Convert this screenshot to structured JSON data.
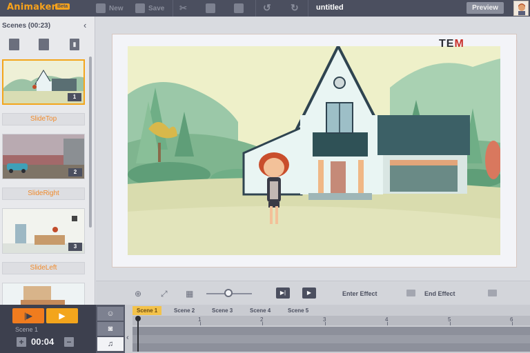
{
  "header": {
    "logo": "Animaker",
    "beta": "Beta",
    "new_label": "New",
    "save_label": "Save",
    "project_title": "untitled",
    "preview_label": "Preview"
  },
  "scenes_panel": {
    "title": "Scenes (00:23)",
    "transitions": [
      "SlideTop",
      "SlideRight",
      "SlideLeft"
    ],
    "scene_numbers": [
      "1",
      "2",
      "3"
    ]
  },
  "stage": {
    "brand_prefix": "TE",
    "brand_suffix": "M"
  },
  "effects": {
    "enter_label": "Enter Effect",
    "end_label": "End Effect"
  },
  "timeline": {
    "current_scene": "Scene 1",
    "time": "00:04",
    "tabs": [
      "Scene 1",
      "Scene 2",
      "Scene 3",
      "Scene 4",
      "Scene 5"
    ],
    "ruler": [
      "1",
      "2",
      "3",
      "4",
      "5",
      "6"
    ]
  },
  "colors": {
    "accent_orange": "#f07c1e",
    "accent_yellow": "#f3a51c",
    "dark_chrome": "#4b4f5f"
  }
}
